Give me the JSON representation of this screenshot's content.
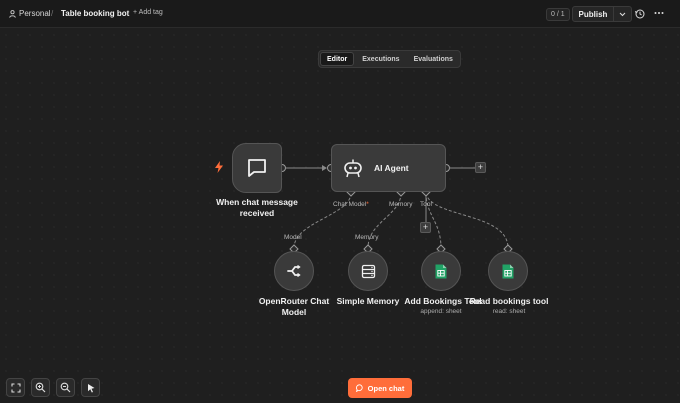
{
  "header": {
    "personal": "Personal",
    "separator": "/",
    "workflow_title": "Table booking bot",
    "add_tag": "+ Add tag",
    "counter": "0 / 1",
    "publish": "Publish"
  },
  "tabs": [
    "Editor",
    "Executions",
    "Evaluations"
  ],
  "active_tab": "Editor",
  "nodes": {
    "trigger": {
      "label_line1": "When chat message",
      "label_line2": "received"
    },
    "agent": {
      "label": "AI Agent"
    },
    "ports": {
      "chat_model": "Chat Model",
      "required_mark": "*",
      "memory": "Memory",
      "tool": "Tool"
    },
    "sub_ports": {
      "model": "Model",
      "memory": "Memory"
    },
    "openrouter": {
      "label_line1": "OpenRouter Chat",
      "label_line2": "Model"
    },
    "memory": {
      "label": "Simple Memory"
    },
    "add_bookings": {
      "label": "Add Bookings Tool",
      "sub": "append: sheet"
    },
    "read_bookings": {
      "label": "Read bookings tool",
      "sub": "read: sheet"
    }
  },
  "footer": {
    "open_chat": "Open chat"
  },
  "colors": {
    "accent": "#ff6d3a",
    "sheets_green": "#21a366",
    "required": "#ff6d3a"
  },
  "icons": [
    "user-icon",
    "chevron-down-icon",
    "history-icon",
    "more-icon",
    "chat-icon",
    "robot-icon",
    "bolt-icon",
    "openrouter-icon",
    "memory-icon",
    "sheets-icon",
    "fit-view-icon",
    "zoom-in-icon",
    "zoom-out-icon",
    "pointer-icon",
    "chat-bubble-icon"
  ]
}
